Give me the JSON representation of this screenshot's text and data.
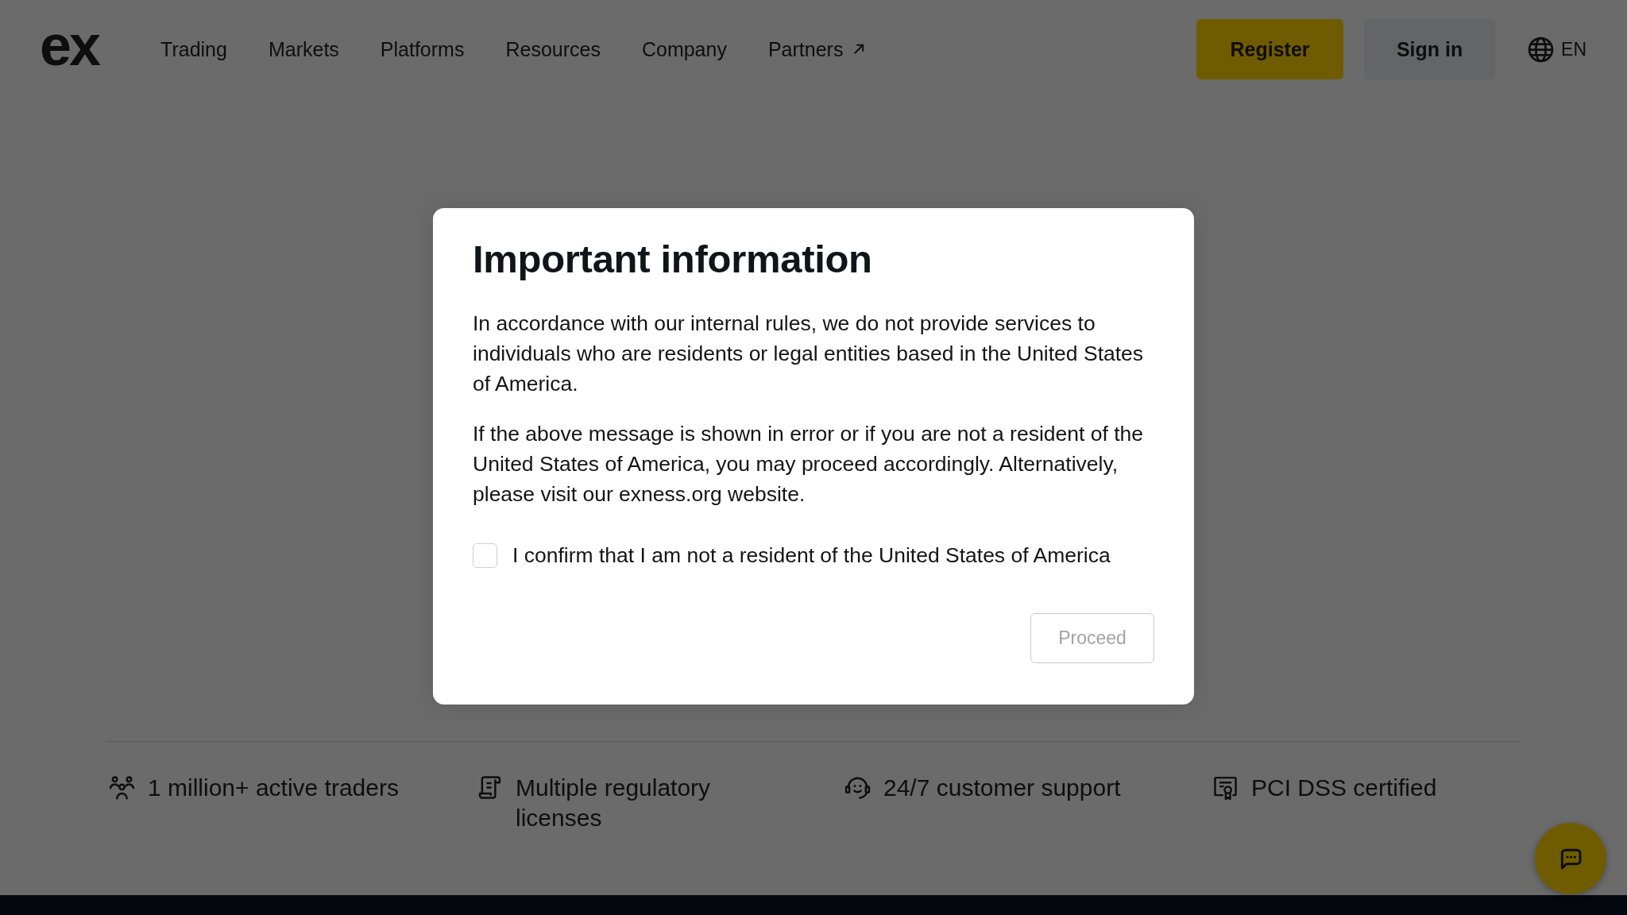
{
  "header": {
    "logo": "ex",
    "nav": [
      {
        "label": "Trading",
        "external": false
      },
      {
        "label": "Markets",
        "external": false
      },
      {
        "label": "Platforms",
        "external": false
      },
      {
        "label": "Resources",
        "external": false
      },
      {
        "label": "Company",
        "external": false
      },
      {
        "label": "Partners",
        "external": true
      }
    ],
    "buttons": [
      {
        "label": "Register",
        "kind": "primary"
      },
      {
        "label": "Sign in",
        "kind": "secondary"
      }
    ],
    "language": "EN"
  },
  "modal": {
    "title": "Important information",
    "paragraphs": [
      "In accordance with our internal rules, we do not provide services to individuals who are residents or legal entities based in the United States of America.",
      "If the above message is shown in error or if you are not a resident of the United States of America, you may proceed accordingly. Alternatively, please visit our exness.org website."
    ],
    "confirm": {
      "label": "I confirm that I am not a resident of the United States of America",
      "checked": false
    },
    "proceed": {
      "label": "Proceed",
      "disabled": true
    }
  },
  "features": [
    "1 million+ active traders",
    "Multiple regulatory licenses",
    "24/7 customer support",
    "PCI DSS certified"
  ]
}
